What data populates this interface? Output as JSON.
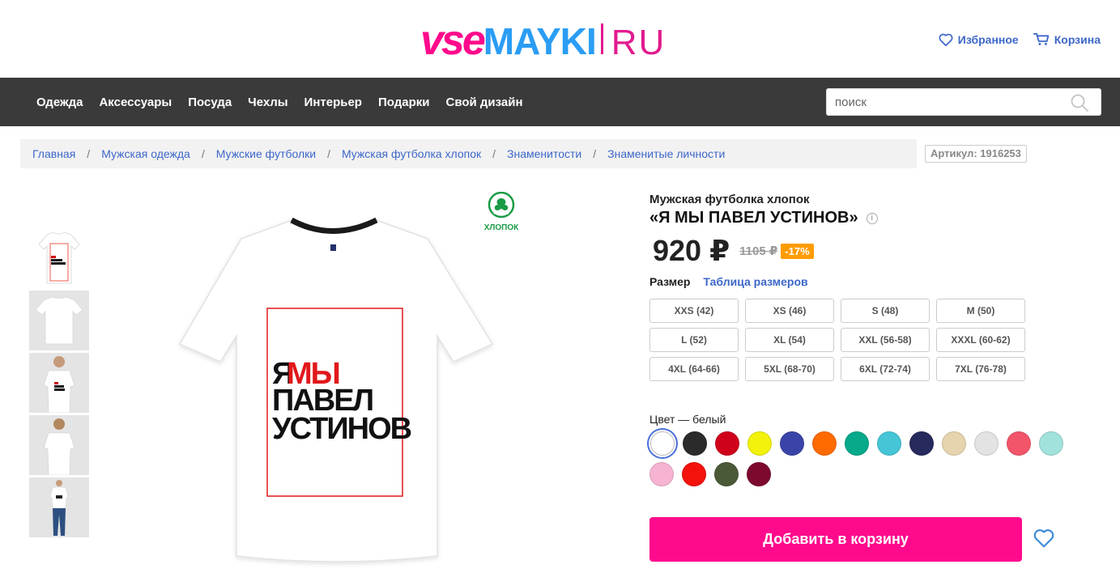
{
  "header": {
    "logo_vse": "vse",
    "logo_mayki": "MAYKI",
    "logo_ru": "RU",
    "favorites_label": "Избранное",
    "cart_label": "Корзина"
  },
  "nav": {
    "items": [
      "Одежда",
      "Аксессуары",
      "Посуда",
      "Чехлы",
      "Интерьер",
      "Подарки",
      "Свой дизайн"
    ],
    "search_placeholder": "поиск"
  },
  "breadcrumb": {
    "items": [
      "Главная",
      "Мужская одежда",
      "Мужские футболки",
      "Мужская футболка хлопок",
      "Знаменитости",
      "Знаменитые личности"
    ],
    "separator": "/"
  },
  "article": "Артикул: 1916253",
  "badge": {
    "cotton_label": "ХЛОПОК",
    "icon": "cotton-icon"
  },
  "print": {
    "line1_a": "Я",
    "line1_b": "МЫ",
    "line2": "ПАВЕЛ",
    "line3": "УСТИНОВ"
  },
  "product": {
    "subtitle": "Мужская футболка хлопок",
    "title": "«Я МЫ ПАВЕЛ УСТИНОВ»",
    "info_icon": "i",
    "price": "920 ₽",
    "old_price": "1105 ₽",
    "discount": "-17%"
  },
  "size": {
    "label": "Размер",
    "table_link": "Таблица размеров",
    "options": [
      "XXS (42)",
      "XS (46)",
      "S (48)",
      "M (50)",
      "L (52)",
      "XL (54)",
      "XXL (56-58)",
      "XXXL (60-62)",
      "4XL (64-66)",
      "5XL (68-70)",
      "6XL (72-74)",
      "7XL (76-78)"
    ]
  },
  "color": {
    "label": "Цвет — белый",
    "selected": "#ffffff",
    "options": [
      "#ffffff",
      "#2b2b2b",
      "#d0021b",
      "#f2f20a",
      "#3a44a8",
      "#ff6b00",
      "#06a98a",
      "#45c5d6",
      "#262a5c",
      "#e6d4ae",
      "#e3e3e3",
      "#f2556a",
      "#a2e2dd",
      "#f6b3d2",
      "#f4120c",
      "#4a5937",
      "#7d0a2e"
    ]
  },
  "actions": {
    "add_to_cart": "Добавить в корзину",
    "favorite_icon": "heart-icon"
  },
  "colors": {
    "brand_pink": "#ff0a8c",
    "brand_blue": "#2a9df4",
    "link": "#3d67c8",
    "nav_bg": "#3a3a3a",
    "discount": "#ff9c00"
  }
}
